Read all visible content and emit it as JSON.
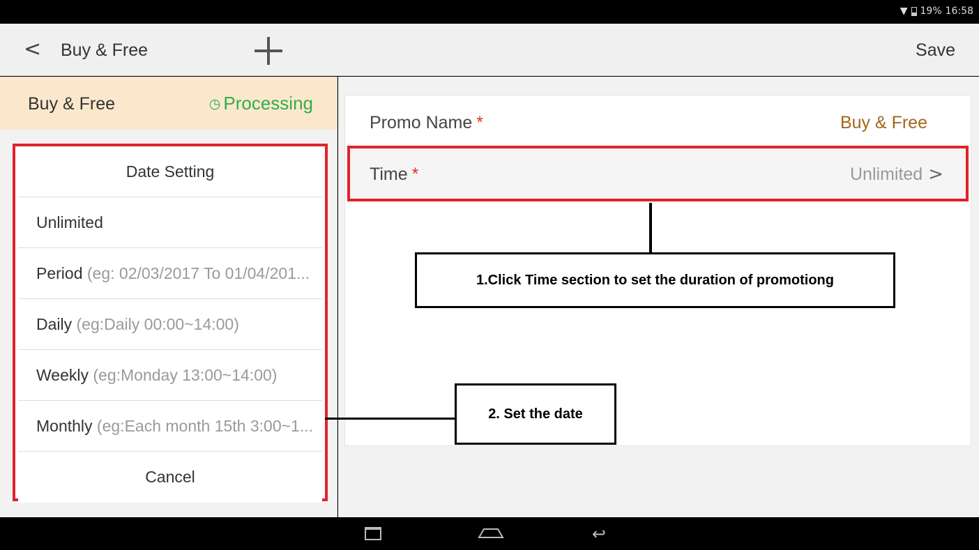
{
  "status_bar": {
    "battery": "19%",
    "time": "16:58"
  },
  "app_bar": {
    "back_icon": "chevron-left-icon",
    "title": "Buy & Free",
    "add_icon": "plus-icon",
    "save_label": "Save"
  },
  "promo_header": {
    "name": "Buy & Free",
    "status": "Processing",
    "status_icon": "clock-icon",
    "status_color": "#2fae4b"
  },
  "date_dialog": {
    "title": "Date Setting",
    "options": [
      {
        "label": "Unlimited",
        "hint": ""
      },
      {
        "label": "Period",
        "hint": " (eg: 02/03/2017 To 01/04/201..."
      },
      {
        "label": "Daily",
        "hint": " (eg:Daily 00:00~14:00)"
      },
      {
        "label": "Weekly",
        "hint": " (eg:Monday 13:00~14:00)"
      },
      {
        "label": "Monthly",
        "hint": " (eg:Each month 15th 3:00~1..."
      }
    ],
    "cancel_label": "Cancel"
  },
  "form": {
    "promo_name_label": "Promo Name",
    "promo_name_value": "Buy & Free",
    "time_label": "Time",
    "time_value": "Unlimited",
    "required_mark": "*"
  },
  "annotations": {
    "step1": "1.Click Time section to set the duration of promotiong",
    "step2": "2. Set the date"
  },
  "colors": {
    "highlight": "#e0232c",
    "accent": "#a4661c",
    "header_bg": "#fbe8cc"
  }
}
